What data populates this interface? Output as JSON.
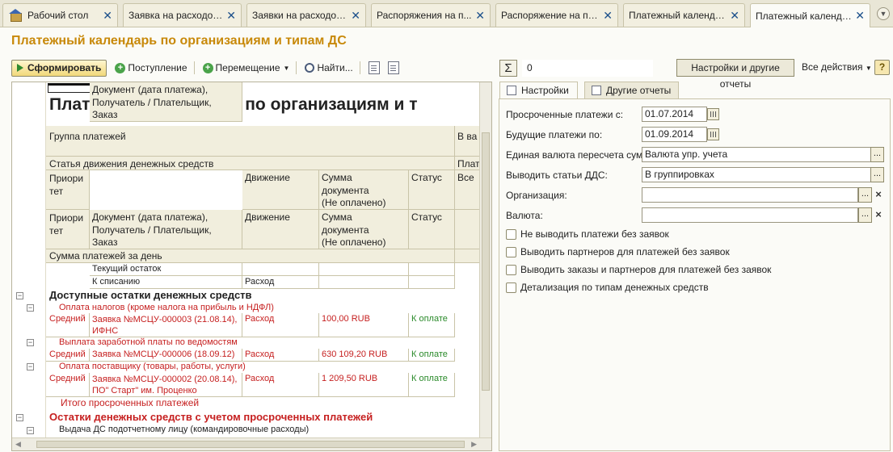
{
  "tabs": [
    {
      "label": "Рабочий стол"
    },
    {
      "label": "Заявка на расходов..."
    },
    {
      "label": "Заявки на расходов..."
    },
    {
      "label": "Распоряжения на п..."
    },
    {
      "label": "Распоряжение на пе..."
    },
    {
      "label": "Платежный календарь"
    },
    {
      "label": "Платежный календа..."
    }
  ],
  "page": {
    "title": "Платежный календарь по организациям и типам ДС"
  },
  "toolbar": {
    "generate": "Сформировать",
    "receipt": "Поступление",
    "move": "Перемещение",
    "find": "Найти...",
    "sum_value": "0",
    "settings": "Настройки и другие отчеты",
    "all_actions": "Все действия",
    "help": "?"
  },
  "report": {
    "title": "Платежный календарь по организациям и т",
    "group_header": "Группа платежей",
    "right_header": "В ва",
    "article_header": "Статья движения денежных средств",
    "right_sub1": "Плат",
    "right_sub2": "Все",
    "col_priority": "Приори тет",
    "col_priority_l1": "Приори",
    "col_priority_l2": "тет",
    "col_doc_l1": "Документ (дата платежа),",
    "col_doc_l2": "Получатель / Плательщик,",
    "col_doc_l3": "Заказ",
    "col_move": "Движение",
    "col_sum_l1": "Сумма",
    "col_sum_l2": "документа",
    "col_sum_l3": "(Не оплачено)",
    "col_status": "Статус",
    "day_total": "Сумма платежей за день",
    "current_balance": "Текущий остаток",
    "write_off": "К списанию",
    "expense": "Расход",
    "available": "Доступные остатки денежных средств",
    "g1": "Оплата налогов (кроме налога на прибыль и НДФЛ)",
    "r1_prio": "Средний",
    "r1_doc_l1": "Заявка №МСЦУ-000003 (21.08.14),",
    "r1_doc_l2": "ИФНС",
    "r1_move": "Расход",
    "r1_sum": "100,00 RUB",
    "r1_status": "К оплате",
    "g2": "Выплата заработной платы по ведомостям",
    "r2_prio": "Средний",
    "r2_doc_l1": "Заявка №МСЦУ-000006 (18.09.12)",
    "r2_move": "Расход",
    "r2_sum": "630 109,20 RUB",
    "r2_status": "К оплате",
    "g3": "Оплата поставщику (товары, работы, услуги)",
    "r3_prio": "Средний",
    "r3_doc_l1": "Заявка №МСЦУ-000002 (20.08.14),",
    "r3_doc_l2": "ПО\" Старт\" им. Проценко",
    "r3_move": "Расход",
    "r3_sum": "1 209,50 RUB",
    "r3_status": "К оплате",
    "overdue_total": "Итого просроченных платежей",
    "balances_overdue": "Остатки денежных средств с учетом просроченных платежей",
    "last_row": "Выдача ДС подотчетному лицу (командировочные расходы)"
  },
  "panel": {
    "tab_settings": "Настройки",
    "tab_other": "Другие отчеты",
    "overdue_from_label": "Просроченные платежи с:",
    "overdue_from_value": "01.07.2014",
    "future_to_label": "Будущие платежи по:",
    "future_to_value": "01.09.2014",
    "currency_conv_label": "Единая валюта пересчета сумм:",
    "currency_conv_value": "Валюта упр. учета",
    "dds_label": "Выводить статьи ДДС:",
    "dds_value": "В группировках",
    "org_label": "Организация:",
    "org_value": "",
    "currency_label": "Валюта:",
    "currency_value": "",
    "chk1": "Не выводить платежи без заявок",
    "chk2": "Выводить партнеров для платежей без заявок",
    "chk3": "Выводить заказы и партнеров для платежей без заявок",
    "chk4": "Детализация по типам денежных средств",
    "dots": "...",
    "x": "×"
  },
  "colors": {
    "accent_title": "#c8890a",
    "red_text": "#c62020",
    "green_text": "#2a8a2a",
    "header_fill": "#f1eedd"
  }
}
